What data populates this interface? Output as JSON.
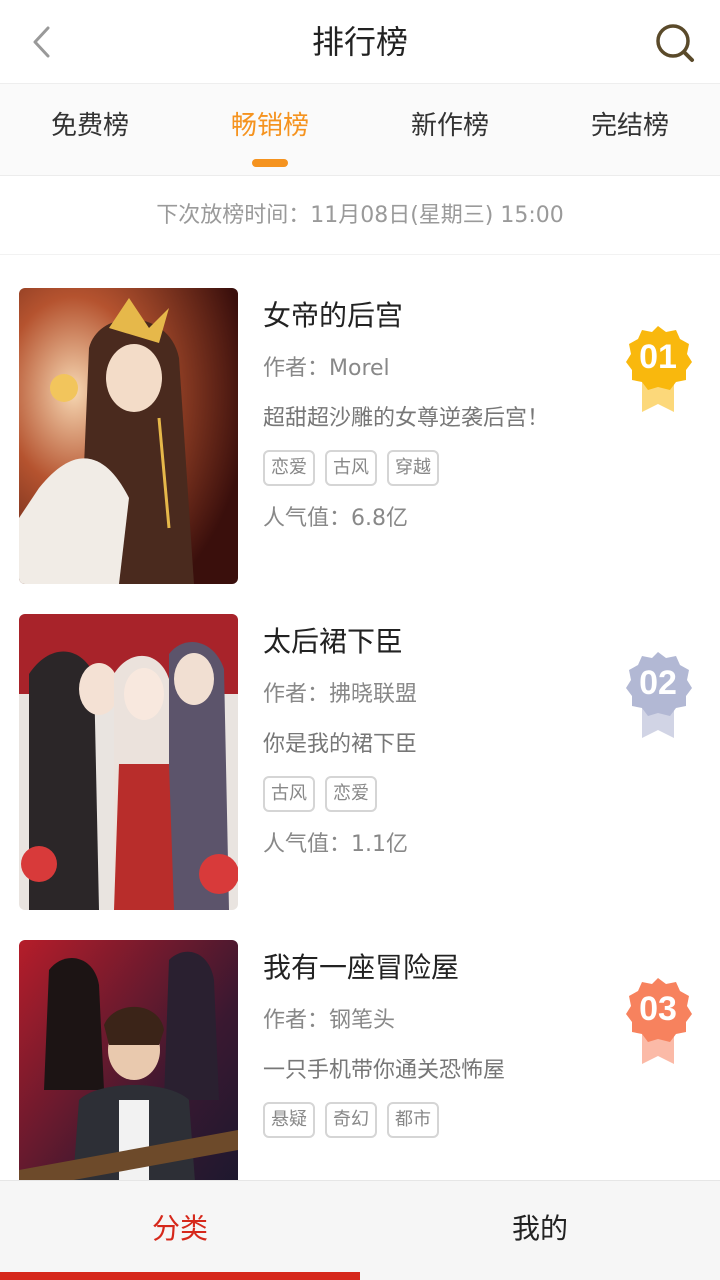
{
  "header": {
    "title": "排行榜",
    "back_icon": "chevron-left-icon",
    "search_icon": "search-icon"
  },
  "tabs": [
    {
      "label": "免费榜",
      "active": false
    },
    {
      "label": "畅销榜",
      "active": true
    },
    {
      "label": "新作榜",
      "active": false
    },
    {
      "label": "完结榜",
      "active": false
    }
  ],
  "notice": "下次放榜时间：11月08日(星期三) 15:00",
  "colors": {
    "accent": "#f5931f",
    "bottom_active": "#d6281b",
    "rank1": "#f9b80d",
    "rank2": "#b2b8d4",
    "rank3": "#f7825e"
  },
  "items": [
    {
      "rank": "01",
      "title": "女帝的后宫",
      "author": "作者：Morel",
      "desc": "超甜超沙雕的女尊逆袭后宫！",
      "tags": [
        "恋爱",
        "古风",
        "穿越"
      ],
      "popularity": "人气值：6.8亿"
    },
    {
      "rank": "02",
      "title": "太后裙下臣",
      "author": "作者：拂晓联盟",
      "desc": "你是我的裙下臣",
      "tags": [
        "古风",
        "恋爱"
      ],
      "popularity": "人气值：1.1亿"
    },
    {
      "rank": "03",
      "title": "我有一座冒险屋",
      "author": "作者：钢笔头",
      "desc": "一只手机带你通关恐怖屋",
      "tags": [
        "悬疑",
        "奇幻",
        "都市"
      ],
      "popularity": ""
    }
  ],
  "bottom_nav": [
    {
      "label": "分类",
      "active": true
    },
    {
      "label": "我的",
      "active": false
    }
  ]
}
